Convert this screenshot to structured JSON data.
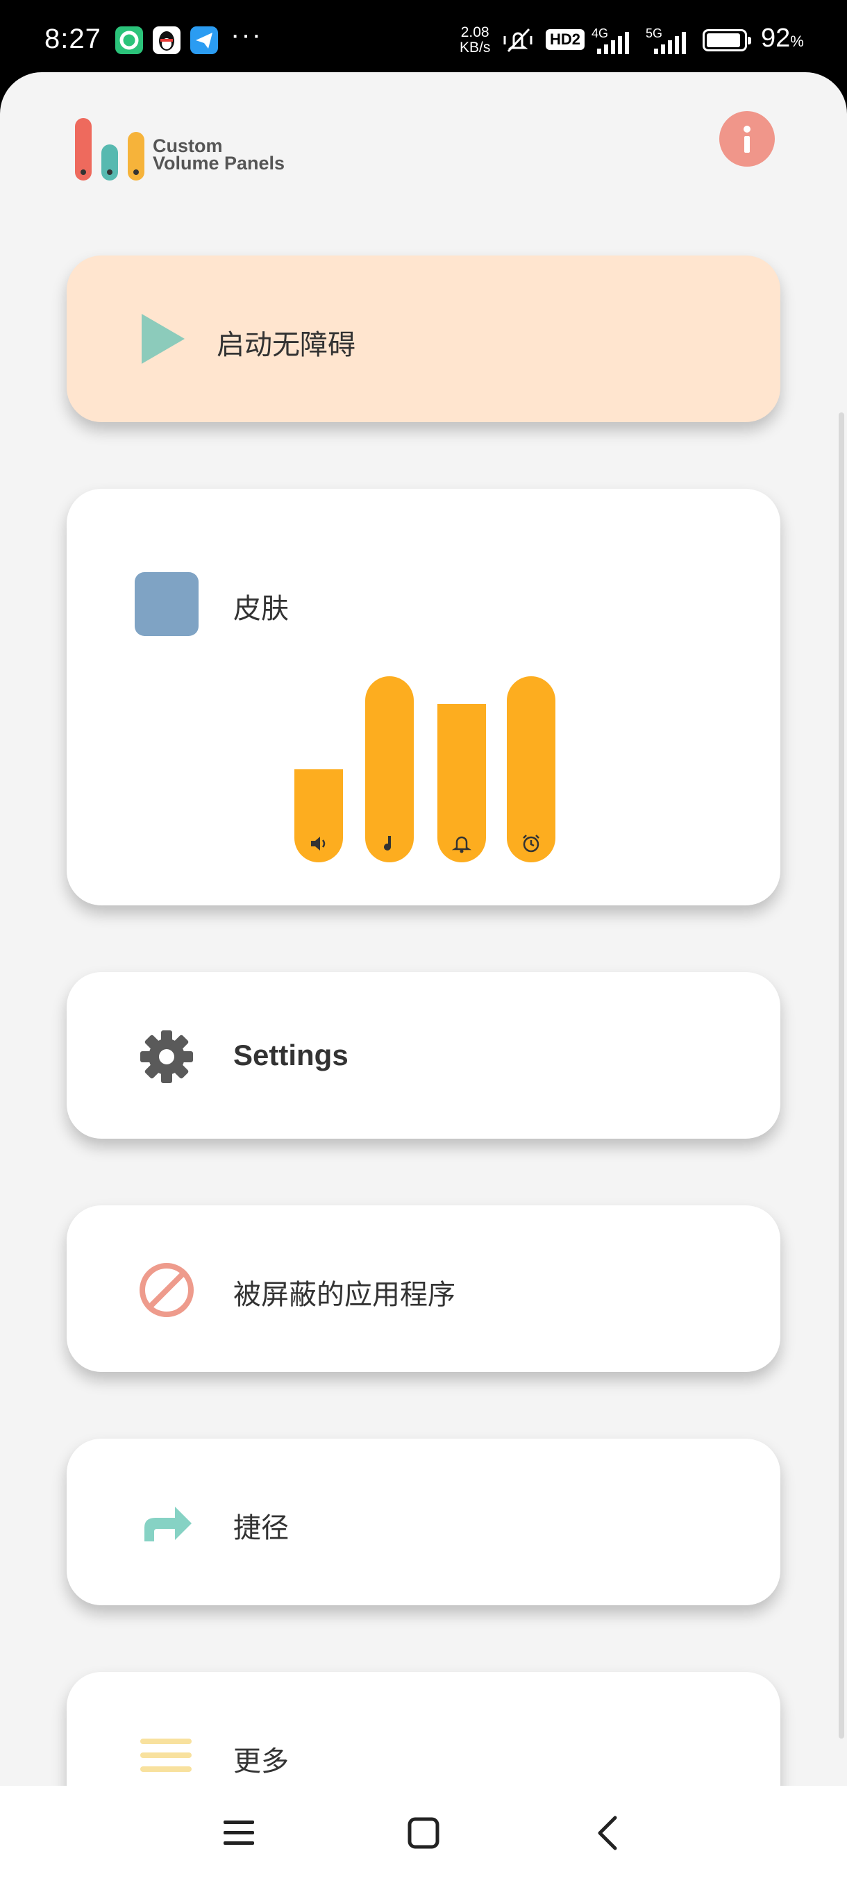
{
  "status_bar": {
    "time": "8:27",
    "net_speed_value": "2.08",
    "net_speed_unit": "KB/s",
    "hd_badge": "HD2",
    "net_4g": "4G",
    "net_5g": "5G",
    "battery_percent": "92",
    "battery_percent_sign": "%",
    "battery_level": 0.92,
    "more_indicator": "···",
    "app_icons": [
      "chat-app-icon",
      "qq-penguin-icon",
      "send-arrow-icon"
    ]
  },
  "header": {
    "logo_line1": "Custom",
    "logo_line2": "Volume Panels",
    "info_icon": "info-icon"
  },
  "cards": {
    "accessibility": {
      "label": "启动无障碍",
      "icon": "play-icon"
    },
    "skin": {
      "label": "皮肤",
      "icon": "color-swatch"
    },
    "settings": {
      "label": "Settings",
      "icon": "gear-icon"
    },
    "blocked_apps": {
      "label": "被屏蔽的应用程序",
      "icon": "block-icon"
    },
    "shortcuts": {
      "label": "捷径",
      "icon": "share-arrow-icon"
    },
    "more": {
      "label": "更多",
      "icon": "menu-lines-icon"
    }
  },
  "skin_preview": {
    "bars": [
      {
        "name": "media",
        "icon": "speaker-icon",
        "level": 0.5
      },
      {
        "name": "music",
        "icon": "music-note-icon",
        "level": 1.0
      },
      {
        "name": "ring",
        "icon": "bell-icon",
        "level": 0.85
      },
      {
        "name": "alarm",
        "icon": "alarm-clock-icon",
        "level": 1.0
      }
    ]
  },
  "colors": {
    "accent_orange": "#fdad1f",
    "accessibility_card_bg": "#ffe5cf",
    "skin_swatch": "#7fa3c4",
    "info_button": "#f0968a",
    "play_icon": "#8ccbbb",
    "block_icon": "#ee9b8c",
    "shortcut_icon": "#86d2c4",
    "more_icon": "#f8e19e"
  },
  "nav_bar": {
    "buttons": [
      "menu-icon",
      "home-icon",
      "back-icon"
    ]
  }
}
